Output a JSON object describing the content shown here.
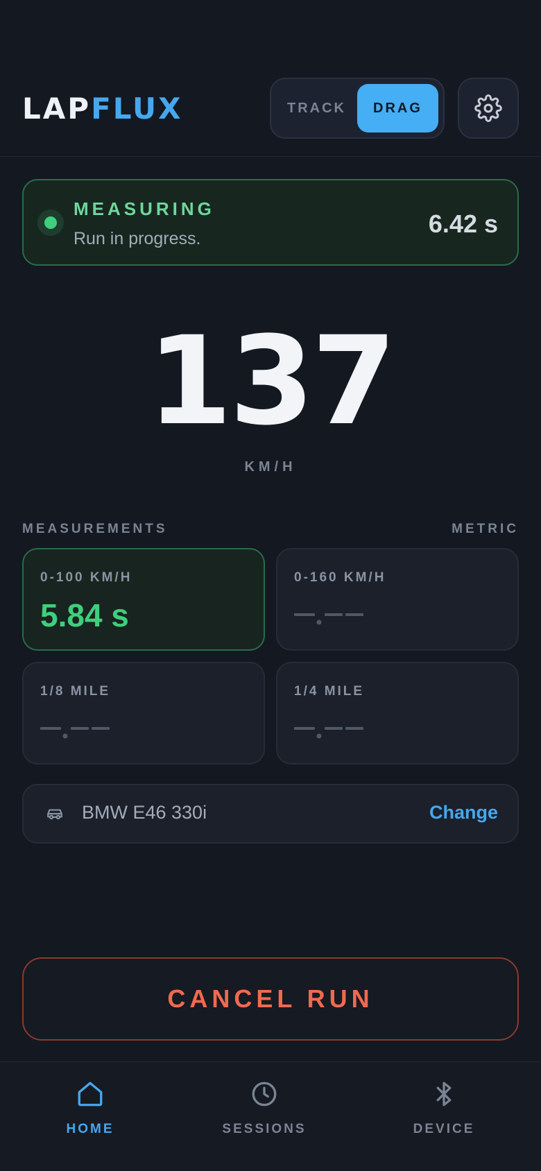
{
  "header": {
    "logo_part1": "LAP",
    "logo_part2": "FLUX",
    "mode_tabs": [
      "TRACK",
      "DRAG"
    ],
    "active_mode": "DRAG",
    "settings_icon": "gear-icon"
  },
  "status": {
    "title": "MEASURING",
    "subtitle": "Run in progress.",
    "elapsed": "6.42 s",
    "color": "#3fcf7c"
  },
  "speed": {
    "value": "137",
    "unit": "KM/H"
  },
  "measurements": {
    "title": "MEASUREMENTS",
    "units": "METRIC",
    "items": [
      {
        "label": "0-100 KM/H",
        "value": "5.84 s",
        "done": true
      },
      {
        "label": "0-160 KM/H",
        "value": "",
        "done": false
      },
      {
        "label": "1/8 MILE",
        "value": "",
        "done": false
      },
      {
        "label": "1/4 MILE",
        "value": "",
        "done": false
      }
    ]
  },
  "vehicle": {
    "icon": "car-icon",
    "name": "BMW E46 330i",
    "action": "Change"
  },
  "cancel_button": "CANCEL RUN",
  "nav": {
    "items": [
      {
        "label": "HOME",
        "icon": "home-icon",
        "active": true
      },
      {
        "label": "SESSIONS",
        "icon": "clock-icon",
        "active": false
      },
      {
        "label": "DEVICE",
        "icon": "bluetooth-icon",
        "active": false
      }
    ]
  },
  "colors": {
    "accent": "#45a8ef",
    "success": "#3fcf7c",
    "danger": "#f06a50",
    "background": "#141821"
  }
}
